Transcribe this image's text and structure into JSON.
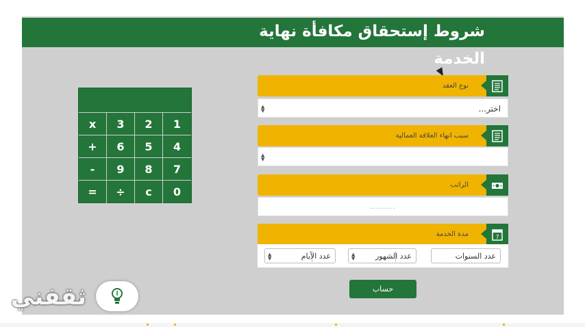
{
  "header": {
    "title": "شروط إستحقاق مكافأة نهاية الخدمة"
  },
  "calculator": {
    "rows": [
      [
        "x",
        "3",
        "2",
        "1"
      ],
      [
        "+",
        "6",
        "5",
        "4"
      ],
      [
        "-",
        "9",
        "8",
        "7"
      ],
      [
        "=",
        "÷",
        "c",
        "0"
      ]
    ]
  },
  "form": {
    "contract_type": {
      "label": "نوع العقد",
      "value": "اختر..."
    },
    "termination_reason": {
      "label": "سبب انهاء العلاقة العمالية",
      "value": ""
    },
    "salary": {
      "label": "الراتب",
      "placeholder": "........."
    },
    "service_period": {
      "label": "مدة الخدمة",
      "years_label": "عدد السنوات",
      "months_label": "عدد الشهور",
      "days_label": "عدد الأيام"
    },
    "submit_label": "حساب"
  },
  "watermark": {
    "brand": "ثقفني"
  },
  "colors": {
    "green": "#23753a",
    "gold": "#f0b400",
    "panel": "#cfcfcf"
  },
  "icons": [
    "document-icon",
    "document-icon",
    "money-icon",
    "calendar-icon",
    "lightbulb-icon",
    "select-arrows-icon"
  ]
}
